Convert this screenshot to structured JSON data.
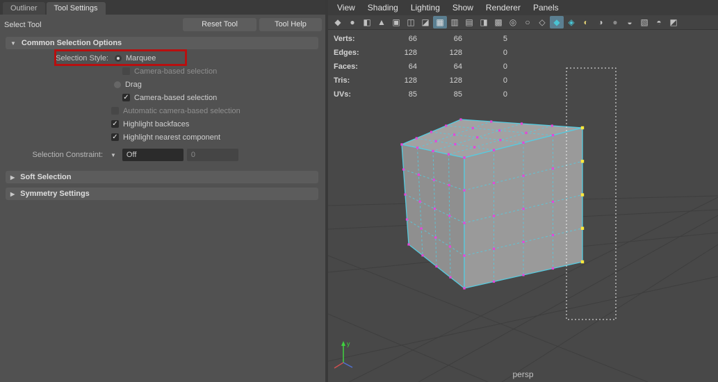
{
  "left_panel": {
    "tabs": [
      {
        "label": "Outliner"
      },
      {
        "label": "Tool Settings"
      }
    ],
    "tool_title": "Select Tool",
    "reset_button": "Reset Tool",
    "help_button": "Tool Help",
    "sections": {
      "common": {
        "title": "Common Selection Options",
        "expanded": true
      },
      "soft": {
        "title": "Soft Selection",
        "expanded": false
      },
      "symmetry": {
        "title": "Symmetry Settings",
        "expanded": false
      }
    },
    "options": {
      "selection_style_label": "Selection Style:",
      "marquee": "Marquee",
      "camera_based_1": "Camera-based selection",
      "drag": "Drag",
      "camera_based_2": "Camera-based selection",
      "auto_camera_based": "Automatic camera-based selection",
      "highlight_backfaces": "Highlight backfaces",
      "highlight_nearest": "Highlight nearest component",
      "constraint_label": "Selection Constraint:",
      "constraint_value": "Off",
      "constraint_number": "0"
    }
  },
  "glyphs": {
    "triangle_down": "▼",
    "triangle_right": "▶",
    "check": "✓",
    "dropdown": "▼"
  },
  "annotation": {
    "color": "#b80f0f"
  },
  "viewport": {
    "menus": [
      "View",
      "Shading",
      "Lighting",
      "Show",
      "Renderer",
      "Panels"
    ],
    "toolbar_icons": [
      {
        "name": "select-camera-icon",
        "glyph": "◆"
      },
      {
        "name": "lock-camera-icon",
        "glyph": "●"
      },
      {
        "name": "camera-attributes-icon",
        "glyph": "◧"
      },
      {
        "name": "bookmark-icon",
        "glyph": "▲"
      },
      {
        "name": "image-plane-icon",
        "glyph": "▣"
      },
      {
        "name": "2d-pan-zoom-icon",
        "glyph": "◫"
      },
      {
        "name": "grease-pencil-icon",
        "glyph": "◪"
      },
      {
        "name": "grid-icon",
        "glyph": "▦",
        "active": true,
        "color": "#e0e0e0"
      },
      {
        "name": "film-gate-icon",
        "glyph": "▥"
      },
      {
        "name": "resolution-gate-icon",
        "glyph": "▤"
      },
      {
        "name": "gate-mask-icon",
        "glyph": "◨"
      },
      {
        "name": "field-chart-icon",
        "glyph": "▩"
      },
      {
        "name": "safe-action-icon",
        "glyph": "◎"
      },
      {
        "name": "safe-title-icon",
        "glyph": "○"
      },
      {
        "name": "wireframe-icon",
        "glyph": "◇"
      },
      {
        "name": "shaded-icon",
        "glyph": "◆",
        "active": true,
        "color": "#49c4d4"
      },
      {
        "name": "textured-icon",
        "glyph": "◈",
        "color": "#49c4d4"
      },
      {
        "name": "use-all-lights-icon",
        "glyph": "◐",
        "color": "#d8c872"
      },
      {
        "name": "shadows-icon",
        "glyph": "◑"
      },
      {
        "name": "screen-space-ao-icon",
        "glyph": "●",
        "color": "#8a8a8a"
      },
      {
        "name": "motion-blur-icon",
        "glyph": "◒"
      },
      {
        "name": "multisample-icon",
        "glyph": "▧"
      },
      {
        "name": "xray-icon",
        "glyph": "◓"
      },
      {
        "name": "isolate-select-icon",
        "glyph": "◩"
      }
    ],
    "hud": {
      "rows": [
        {
          "label": "Verts:",
          "total": "66",
          "shown": "66",
          "selected": "5"
        },
        {
          "label": "Edges:",
          "total": "128",
          "shown": "128",
          "selected": "0"
        },
        {
          "label": "Faces:",
          "total": "64",
          "shown": "64",
          "selected": "0"
        },
        {
          "label": "Tris:",
          "total": "128",
          "shown": "128",
          "selected": "0"
        },
        {
          "label": "UVs:",
          "total": "85",
          "shown": "85",
          "selected": "0"
        }
      ]
    },
    "camera_label": "persp",
    "axis_label_y": "y",
    "colors": {
      "edge": "#56cbe0",
      "vertex": "#e645d9",
      "vertex_selected": "#ffe93c",
      "marquee": "#f2f2f2",
      "grid": "#3e3e3e",
      "face_top": "#a2a2a2",
      "face_left": "#8f8f8f",
      "face_right": "#9a9a9a",
      "axis_y": "#3fd13f",
      "axis_x": "#d05050",
      "axis_z": "#5070d0"
    }
  }
}
